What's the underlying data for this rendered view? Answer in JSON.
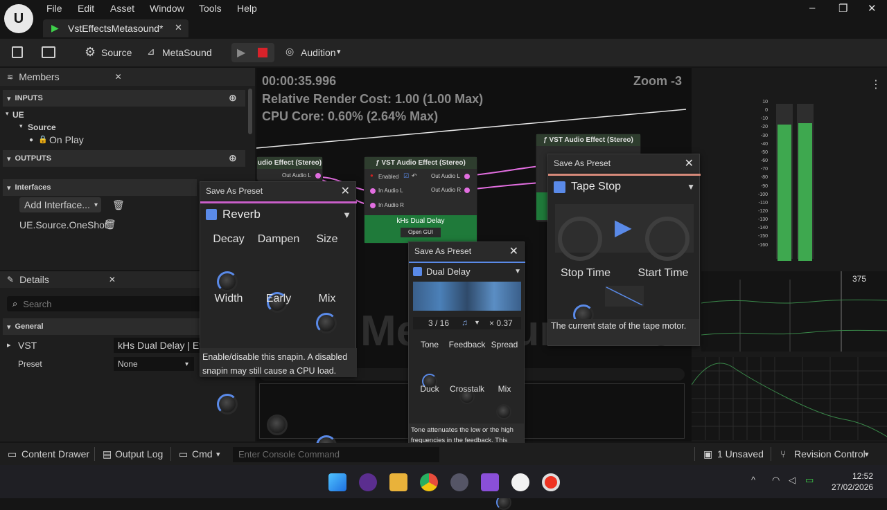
{
  "app": {
    "logo_text": "U"
  },
  "menu": [
    "File",
    "Edit",
    "Asset",
    "Window",
    "Tools",
    "Help"
  ],
  "window_controls": [
    "–",
    "❐",
    "✕"
  ],
  "document_tab": {
    "title": "VstEffectsMetasound*",
    "close": "✕"
  },
  "toolbar": {
    "source": "Source",
    "metasound": "MetaSound",
    "audition": "Audition"
  },
  "members": {
    "title": "Members",
    "close": "✕",
    "inputs_header": "INPUTS",
    "ue_label": "UE",
    "source_label": "Source",
    "on_play": "On Play",
    "outputs_header": "OUTPUTS",
    "interfaces_header": "Interfaces",
    "add_interface": "Add Interface...",
    "interface_item": "UE.Source.OneShot"
  },
  "details": {
    "title": "Details",
    "close": "✕",
    "search_placeholder": "Search",
    "general_header": "General",
    "vst_label": "VST",
    "vst_value": "kHs Dual Delay | Eff",
    "preset_label": "Preset",
    "preset_value": "None"
  },
  "graph": {
    "time": "00:00:35.996",
    "render_cost": "Relative Render Cost: 1.00 (1.00 Max)",
    "cpu_core": "CPU Core: 0.60% (2.64% Max)",
    "zoom": "Zoom -3",
    "watermark": "MetaSound",
    "node_left_title": "udio Effect (Stereo)",
    "node_left_out": "Out Audio L",
    "node_mid_title": "ƒ VST Audio Effect (Stereo)",
    "node_mid_enabled": "Enabled",
    "node_mid_in_l": "In Audio L",
    "node_mid_in_r": "In Audio R",
    "node_mid_out_l": "Out Audio L",
    "node_mid_out_r": "Out Audio R",
    "node_mid_plugin": "kHs Dual Delay",
    "node_mid_open_gui": "Open GUI",
    "node_right_title": "ƒ VST Audio Effect (Stereo)"
  },
  "reverb_popup": {
    "header": "Save As Preset",
    "close": "✕",
    "name": "Reverb",
    "knobs_row1": [
      "Decay",
      "Dampen",
      "Size"
    ],
    "knobs_row2": [
      "Width",
      "Early",
      "Mix"
    ],
    "tooltip": "Enable/disable this snapin. A disabled snapin may still cause a CPU load."
  },
  "delay_popup": {
    "header": "Save As Preset",
    "close": "✕",
    "name": "Dual Delay",
    "time": "3 / 16",
    "note_icon": "♫",
    "multiplier": "× 0.37",
    "knobs_row1": [
      "Tone",
      "Feedback",
      "Spread"
    ],
    "knobs_row2": [
      "Duck",
      "Crosstalk",
      "Mix"
    ],
    "tooltip": "Tone attenuates the low or the high frequencies in the feedback. This"
  },
  "tape_popup": {
    "header": "Save As Preset",
    "close": "✕",
    "name": "Tape Stop",
    "stop_time": "Stop Time",
    "start_time": "Start Time",
    "tooltip": "The current state of the tape motor."
  },
  "meters": {
    "scale": [
      "10",
      "0",
      "-10",
      "-20",
      "-30",
      "-40",
      "-50",
      "-60",
      "-70",
      "-80",
      "-90",
      "-100",
      "-110",
      "-120",
      "-130",
      "-140",
      "-150",
      "-160"
    ],
    "left_level_db": -15,
    "right_level_db": -13,
    "timeline_value": "375"
  },
  "statusbar": {
    "content_drawer": "Content Drawer",
    "output_log": "Output Log",
    "cmd": "Cmd",
    "console_placeholder": "Enter Console Command",
    "unsaved": "1 Unsaved",
    "revision_control": "Revision Control"
  },
  "taskbar": {
    "time": "12:52",
    "date": "27/02/2026"
  },
  "colors": {
    "accent_blue": "#5a8ae8",
    "meter_green": "#3ea84f",
    "pin_pink": "#e26ee0",
    "node_green": "#1f7a3a"
  }
}
